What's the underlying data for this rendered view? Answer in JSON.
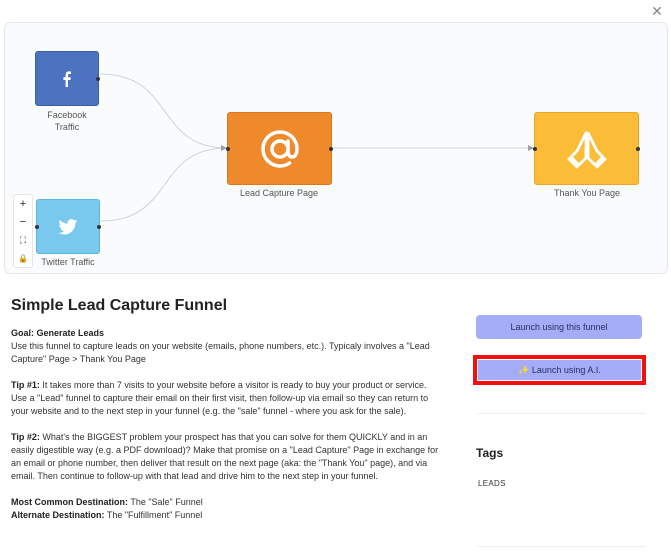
{
  "close_icon_glyph": "✕",
  "nodes": {
    "facebook": {
      "label": "Facebook\nTraffic",
      "icon": "facebook-icon",
      "color": "#4b73c0"
    },
    "twitter": {
      "label": "Twitter Traffic",
      "icon": "twitter-icon",
      "color": "#79c9ef"
    },
    "lead_capture": {
      "label": "Lead Capture Page",
      "icon": "at-sign-icon",
      "color": "#ee8a2c"
    },
    "thank_you": {
      "label": "Thank You Page",
      "icon": "praying-hands-icon",
      "color": "#fbbd37"
    }
  },
  "zoom_controls": {
    "zoom_in": "+",
    "zoom_out": "−",
    "fit": "⛶",
    "lock": "🔒"
  },
  "funnel": {
    "title": "Simple Lead Capture Funnel",
    "goal_label": "Goal: Generate Leads",
    "goal_text": "Use this funnel to capture leads on your website (emails, phone numbers, etc.). Typicaly involves a \"Lead Capture\" Page > Thank You Page",
    "tip1_label": "Tip #1:",
    "tip1_text": " It takes more than 7 visits to your website before a visitor is ready to buy your product or service. Use a \"Lead\" funnel to capture their email on their first visit, then follow-up via email so they can return to your website and to the next step in your funnel (e.g. the \"sale\" funnel - where you ask for the sale).",
    "tip2_label": "Tip #2:",
    "tip2_text": " What's the BIGGEST problem your prospect has that you can solve for them QUICKLY and in an easily digestible way (e.g. a PDF download)? Make that promise on a \"Lead Capture\" Page in exchange for an email or phone number, then deliver that result on the next page (aka: the \"Thank You\" page), and via email. Then continue to follow-up with that lead and drive him to the next step in your funnel.",
    "most_common_label": "Most Common Destination:",
    "most_common_value": " The \"Sale\" Funnel",
    "alternate_label": "Alternate Destination:",
    "alternate_value": " The \"Fulfillment\" Funnel"
  },
  "actions": {
    "launch_funnel": "Launch using this funnel",
    "launch_ai": "✨ Launch using A.I.",
    "highlight_color": "#f20f0f"
  },
  "tags": {
    "heading": "Tags",
    "items": [
      "LEADS"
    ]
  }
}
